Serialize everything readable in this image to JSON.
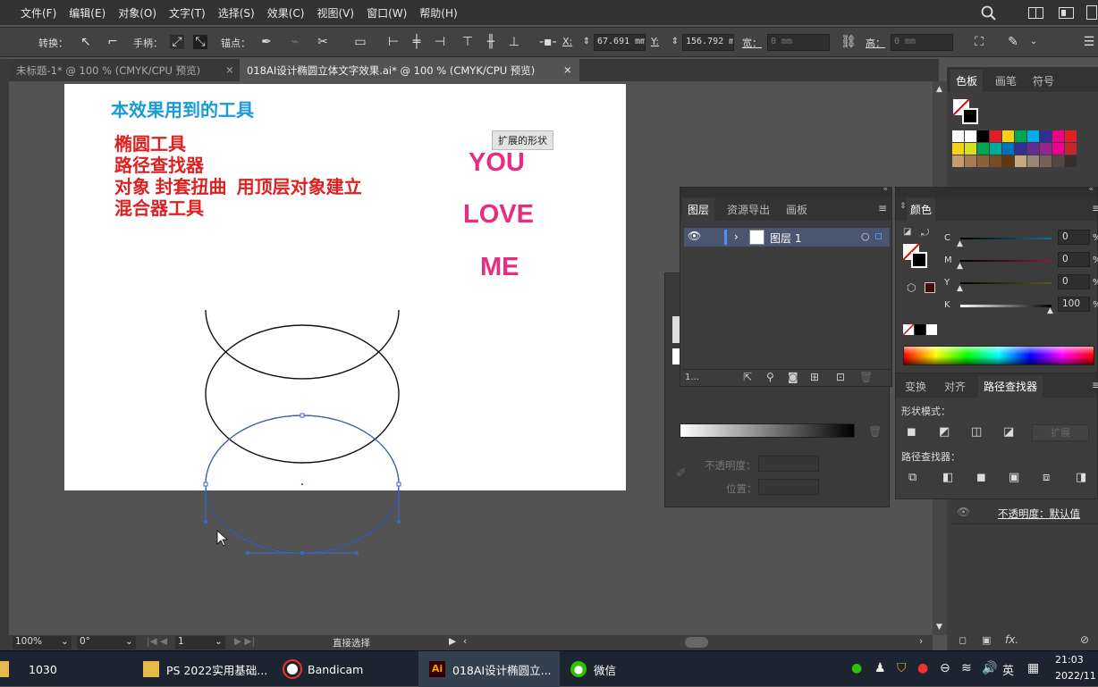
{
  "menubar": {
    "items": [
      "文件(F)",
      "编辑(E)",
      "对象(O)",
      "文字(T)",
      "选择(S)",
      "效果(C)",
      "视图(V)",
      "窗口(W)",
      "帮助(H)"
    ]
  },
  "control_bar": {
    "convert_label": "转换：",
    "handle_label": "手柄：",
    "anchor_label": "锚点：",
    "x_label": "X:",
    "x_value": "67.691 mm",
    "y_label": "Y:",
    "y_value": "156.792 m",
    "width_label": "宽：",
    "width_value": "0 mm",
    "height_label": "高：",
    "height_value": "0 mm"
  },
  "tabs": [
    {
      "label": "未标题-1* @ 100 % (CMYK/CPU 预览)",
      "close": "×"
    },
    {
      "label": "018AI设计椭圆立体文字效果.ai* @ 100 % (CMYK/CPU 预览)",
      "close": "×"
    }
  ],
  "artboard": {
    "title": "本效果用到的工具",
    "tools": [
      "椭圆工具",
      "路径查找器",
      "对象 封套扭曲  用顶层对象建立",
      "混合器工具"
    ],
    "words": [
      "YOU",
      "LOVE",
      "ME"
    ],
    "tooltip": "扩展的形状",
    "colors": {
      "title": "#1a9ad6",
      "tools": "#e02020",
      "words": "#ea2c81",
      "selection": "#3b67d6"
    }
  },
  "status_bar": {
    "zoom": "100%",
    "rotation": "0°",
    "page": "1",
    "tool": "直接选择"
  },
  "right_panel": {
    "tabs": [
      "色板",
      "画笔",
      "符号"
    ]
  },
  "layers_panel": {
    "tabs": [
      "图层",
      "资源导出",
      "画板"
    ],
    "layer_name": "图层 1",
    "count": "1..."
  },
  "color_panel": {
    "title": "颜色",
    "channels": [
      {
        "label": "C",
        "value": "0"
      },
      {
        "label": "M",
        "value": "0"
      },
      {
        "label": "Y",
        "value": "0"
      },
      {
        "label": "K",
        "value": "100"
      }
    ],
    "unit": "%"
  },
  "pathfinder_panel": {
    "tabs": [
      "变换",
      "对齐",
      "路径查找器"
    ],
    "shape_modes_label": "形状模式：",
    "expand_label": "扩展",
    "pathfinders_label": "路径查找器："
  },
  "gradient_panel": {
    "opacity_label": "不透明度：",
    "position_label": "位置："
  },
  "transparency_panel": {
    "opacity_text": "不透明度：默认值",
    "fx_label": "fx."
  },
  "taskbar": {
    "items": [
      {
        "label": "1030",
        "icon": "folder-icon"
      },
      {
        "label": "PS 2022实用基础...",
        "icon": "folder-icon"
      },
      {
        "label": "Bandicam",
        "icon": "record-icon"
      },
      {
        "label": "018AI设计椭圆立...",
        "icon": "illustrator-icon"
      },
      {
        "label": "微信",
        "icon": "wechat-icon"
      }
    ],
    "ime": "英",
    "time": "21:03",
    "date": "2022/11"
  }
}
